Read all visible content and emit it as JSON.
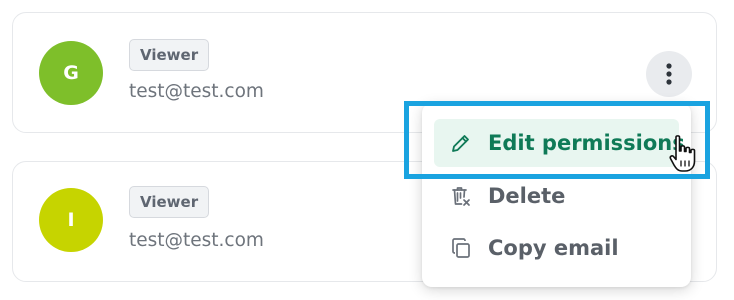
{
  "members": [
    {
      "initial": "G",
      "role": "Viewer",
      "email": "test@test.com",
      "avatar_color": "#7ebf2a"
    },
    {
      "initial": "I",
      "role": "Viewer",
      "email": "test@test.com",
      "avatar_color": "#c6d400"
    }
  ],
  "kebab_menu": {
    "icon": "more-vertical-icon",
    "items": [
      {
        "label": "Edit permissions",
        "icon": "pencil-icon",
        "highlighted": true
      },
      {
        "label": "Delete",
        "icon": "trash-icon"
      },
      {
        "label": "Copy email",
        "icon": "copy-icon"
      }
    ]
  },
  "colors": {
    "highlight_border": "#1aa3e0",
    "active_item_text": "#0f7a57",
    "active_item_bg": "#e8f6f0"
  }
}
